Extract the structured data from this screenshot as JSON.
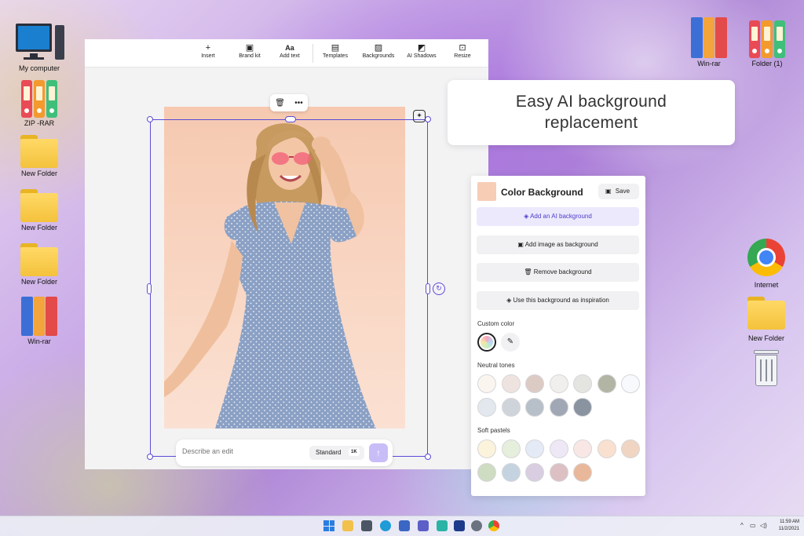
{
  "desktop": {
    "left_icons": [
      {
        "label": "My computer",
        "icon": "computer-icon"
      },
      {
        "label": "ZIP -RAR",
        "icon": "zip-rar-icon"
      },
      {
        "label": "New Folder",
        "icon": "folder-icon"
      },
      {
        "label": "New Folder",
        "icon": "folder-icon"
      },
      {
        "label": "New Folder",
        "icon": "folder-icon"
      },
      {
        "label": "Win-rar",
        "icon": "winrar-icon"
      }
    ],
    "right_icons": [
      {
        "label": "Win-rar",
        "icon": "winrar-icon"
      },
      {
        "label": "Folder (1)",
        "icon": "binder-icon"
      },
      {
        "label": "Internet",
        "icon": "chrome-icon"
      },
      {
        "label": "New Folder",
        "icon": "folder-icon"
      },
      {
        "label": "",
        "icon": "recycle-bin-icon"
      }
    ]
  },
  "editor": {
    "toolbar": [
      {
        "label": "Insert",
        "icon": "plus-icon"
      },
      {
        "label": "Brand kit",
        "icon": "brand-kit-icon"
      },
      {
        "label": "Add text",
        "icon": "text-icon"
      },
      {
        "label": "Templates",
        "icon": "templates-icon"
      },
      {
        "label": "Backgrounds",
        "icon": "backgrounds-icon"
      },
      {
        "label": "AI Shadows",
        "icon": "shadows-icon"
      },
      {
        "label": "Resize",
        "icon": "resize-icon"
      }
    ],
    "prompt": {
      "placeholder": "Describe an edit",
      "quality": "Standard",
      "resolution": "1K"
    }
  },
  "callout": {
    "line1": "Easy AI background",
    "line2": "replacement"
  },
  "panel": {
    "title": "Color Background",
    "current_color": "#f7cdb6",
    "save_label": "Save",
    "buttons": [
      {
        "label": "Add an AI background",
        "icon": "layers-icon"
      },
      {
        "label": "Add image as background",
        "icon": "image-icon"
      },
      {
        "label": "Remove background",
        "icon": "trash-icon"
      },
      {
        "label": "Use this background as inspiration",
        "icon": "layers-icon"
      }
    ],
    "custom_color_label": "Custom color",
    "neutral_label": "Neutral tones",
    "neutral_colors": [
      "#fbf5f0",
      "#efe3df",
      "#dccbc4",
      "#f1efee",
      "#e4e4e1",
      "#b3b5a4",
      "#f8f9fc",
      "#e2e8ee",
      "#cfd4db",
      "#b7c0c9",
      "#a0a8b5",
      "#8a93a0"
    ],
    "pastels_label": "Soft pastels",
    "pastel_colors": [
      "#fbf3dc",
      "#e5efdc",
      "#e4eaf6",
      "#eee8f6",
      "#f9e7e6",
      "#fae0cf",
      "#efd5c2",
      "#cedcc1",
      "#c5d3e0",
      "#d8cde1",
      "#dcc0c4",
      "#e9b89a"
    ]
  },
  "taskbar": {
    "time": "11:59 AM",
    "date": "11/2/2021"
  }
}
